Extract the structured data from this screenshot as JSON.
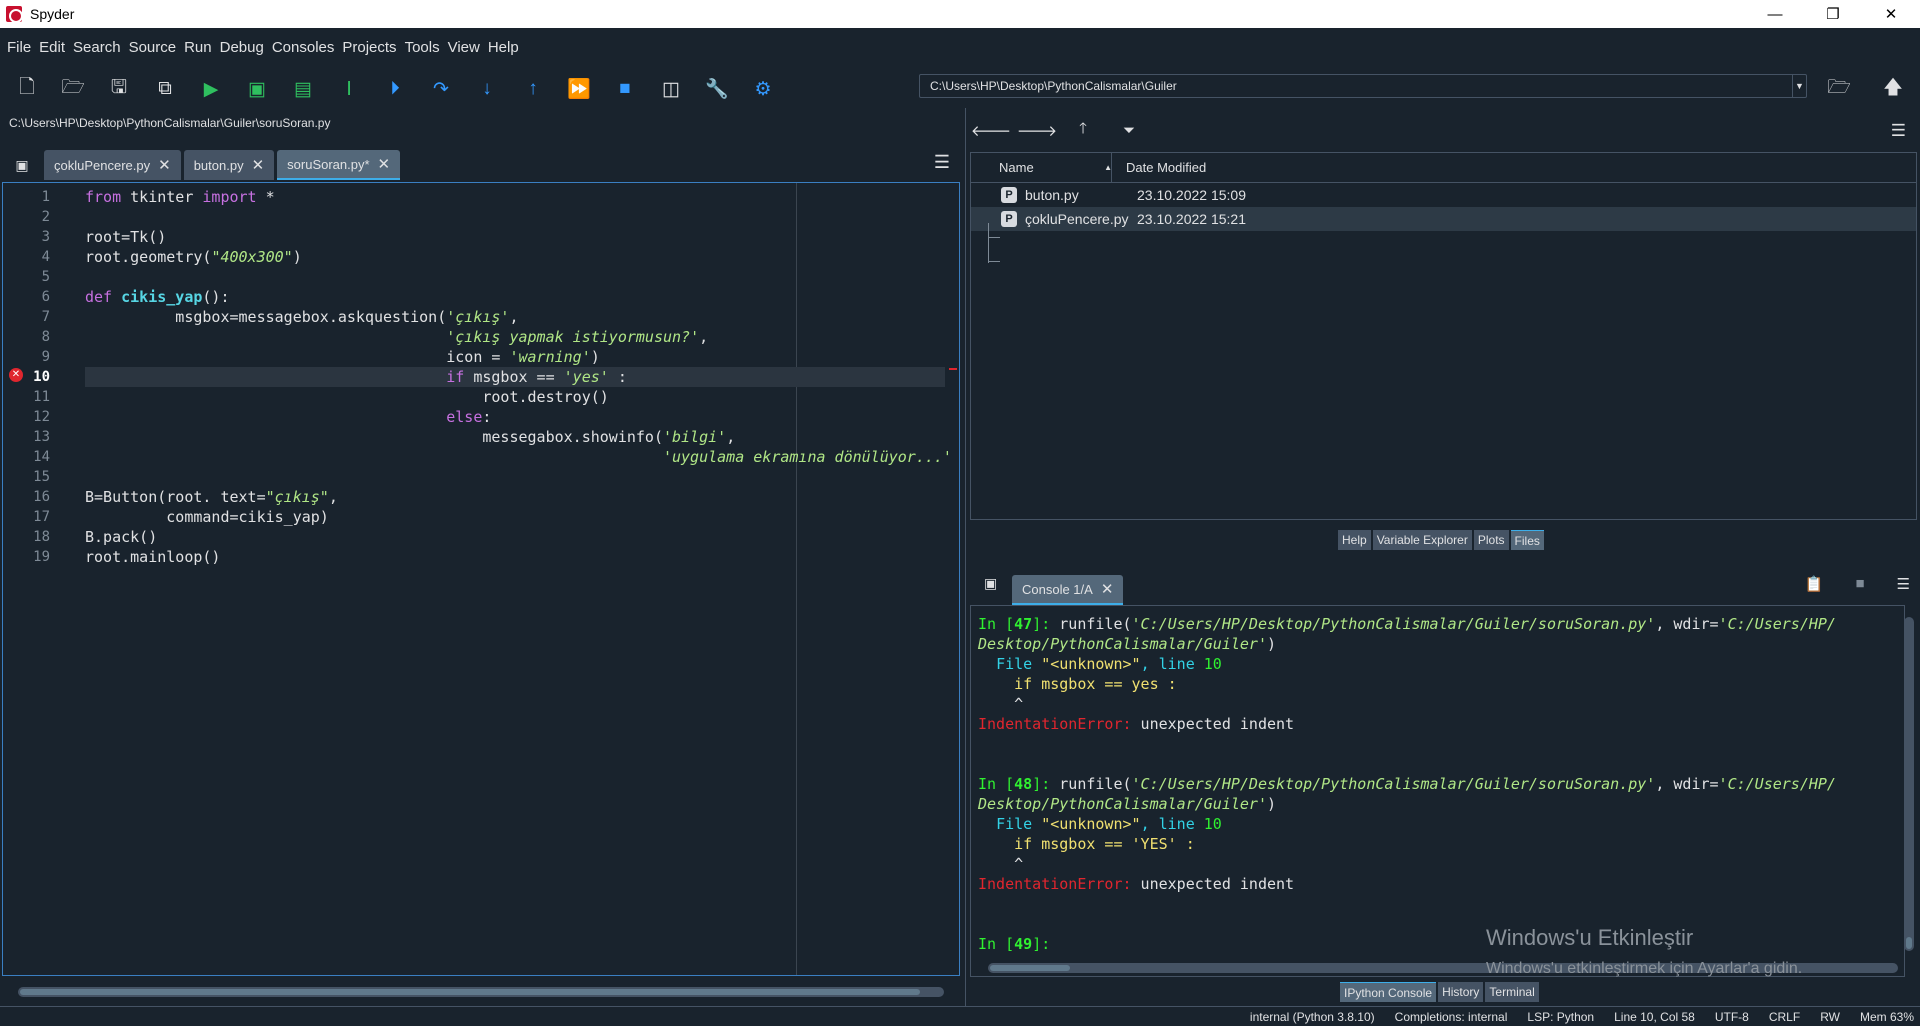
{
  "window": {
    "title": "Spyder",
    "minimize": "—",
    "restore": "❐",
    "close": "✕"
  },
  "menu": [
    "File",
    "Edit",
    "Search",
    "Source",
    "Run",
    "Debug",
    "Consoles",
    "Projects",
    "Tools",
    "View",
    "Help"
  ],
  "toolbar": {
    "path": "C:\\Users\\HP\\Desktop\\PythonCalismalar\\Guiler"
  },
  "editor": {
    "filepath": "C:\\Users\\HP\\Desktop\\PythonCalismalar\\Guiler\\soruSoran.py",
    "tabs": [
      {
        "label": "çokluPencere.py"
      },
      {
        "label": "buton.py"
      },
      {
        "label": "soruSoran.py*"
      }
    ],
    "line_numbers": [
      "1",
      "2",
      "3",
      "4",
      "5",
      "6",
      "7",
      "8",
      "9",
      "10",
      "11",
      "12",
      "13",
      "14",
      "15",
      "16",
      "17",
      "18",
      "19"
    ],
    "current_line": "10"
  },
  "files": {
    "columns": {
      "name": "Name",
      "date": "Date Modified"
    },
    "rows": [
      {
        "name": "buton.py",
        "date": "23.10.2022 15:09"
      },
      {
        "name": "çokluPencere.py",
        "date": "23.10.2022 15:21"
      }
    ],
    "tabs": [
      "Help",
      "Variable Explorer",
      "Plots",
      "Files"
    ]
  },
  "console": {
    "tab": "Console 1/A",
    "tabs": [
      "IPython Console",
      "History",
      "Terminal"
    ],
    "in47": "47",
    "in48": "48",
    "in49": "49",
    "runfile_path": "'C:/Users/HP/Desktop/PythonCalismalar/Guiler/soruSoran.py'",
    "wdir1": "'C:/Users/HP/",
    "wdir2": "Desktop/PythonCalismalar/Guiler'",
    "file_unknown": "\"<unknown>\"",
    "line_no": "10",
    "code1": "    if msgbox == yes :",
    "code2": "    if msgbox == 'YES' :",
    "caret": "    ^",
    "err_name": "IndentationError:",
    "err_msg": " unexpected indent"
  },
  "watermark": {
    "line1": "Windows'u Etkinleştir",
    "line2": "Windows'u etkinleştirmek için Ayarlar'a gidin."
  },
  "status": [
    "internal (Python 3.8.10)",
    "Completions: internal",
    "LSP: Python",
    "Line 10, Col 58",
    "UTF-8",
    "CRLF",
    "RW",
    "Mem 63%"
  ],
  "colors": {
    "bg": "#19232d",
    "accent": "#3daee9",
    "keyword": "#c670e0",
    "string": "#b0e686",
    "error": "#e0262e",
    "prompt": "#30f030"
  }
}
